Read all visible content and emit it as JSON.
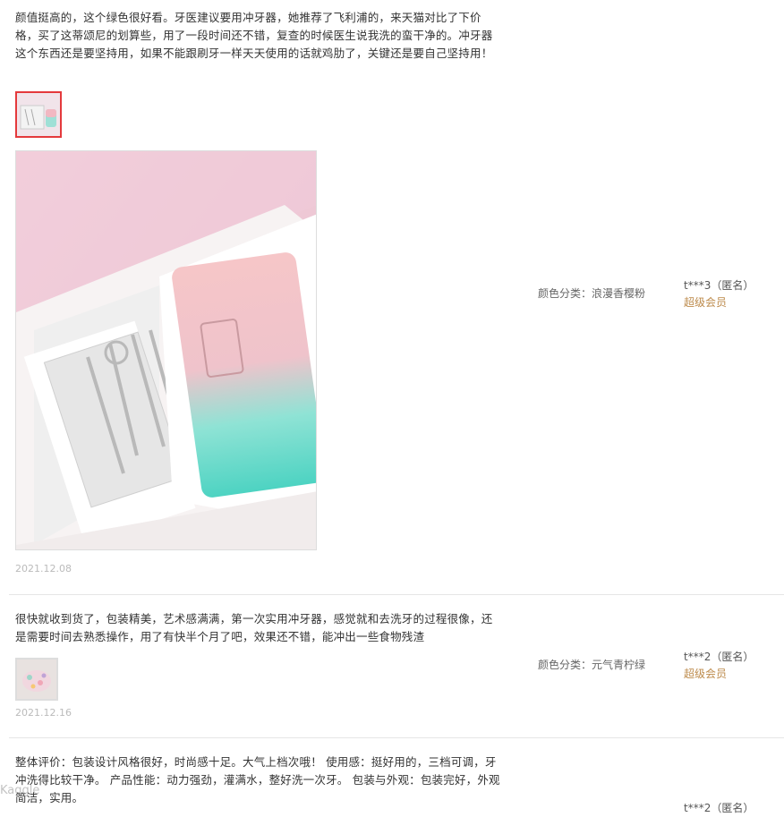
{
  "reviews": [
    {
      "text": "颜值挺高的，这个绿色很好看。牙医建议要用冲牙器，她推荐了飞利浦的，来天猫对比了下价格，买了这蒂颂尼的划算些，用了一段时间还不错，复查的时候医生说我洗的蛮干净的。冲牙器这个东西还是要坚持用，如果不能跟刷牙一样天天使用的话就鸡肋了，关键还是要自己坚持用！",
      "date": "2021.12.08",
      "sku": "颜色分类：浪漫香樱粉",
      "user": "t***3（匿名）",
      "member": "超级会员"
    },
    {
      "text": "很快就收到货了，包装精美，艺术感满满，第一次实用冲牙器，感觉就和去洗牙的过程很像，还是需要时间去熟悉操作，用了有快半个月了吧，效果还不错，能冲出一些食物残渣",
      "date": "2021.12.16",
      "sku": "颜色分类：元气青柠绿",
      "user": "t***2（匿名）",
      "member": "超级会员"
    },
    {
      "text": "整体评价：包装设计风格很好，时尚感十足。大气上档次哦！ 使用感：挺好用的，三档可调，牙冲洗得比较干净。 产品性能：动力强劲，灌满水，整好洗一次牙。 包装与外观：包装完好，外观简洁，实用。",
      "user": "t***2（匿名）"
    }
  ],
  "watermark": "Kaggle"
}
